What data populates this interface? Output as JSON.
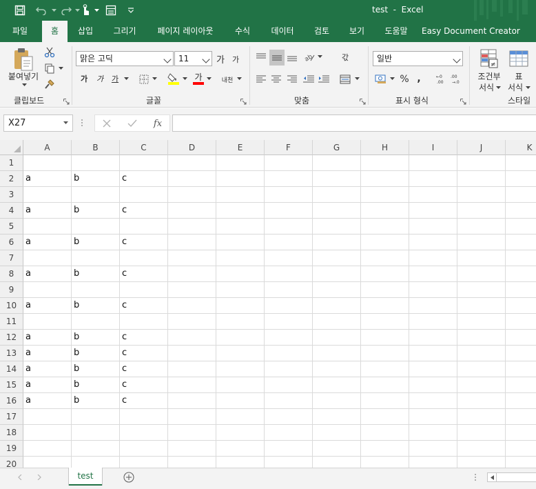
{
  "window": {
    "title": "test  -  Excel",
    "accent_color": "#217346"
  },
  "qat": {
    "icons": [
      "save-icon",
      "undo-icon",
      "redo-icon",
      "touch-mode-icon",
      "form-icon",
      "customize-qat-icon"
    ]
  },
  "tabs": [
    {
      "label": "파일"
    },
    {
      "label": "홈"
    },
    {
      "label": "삽입"
    },
    {
      "label": "그리기"
    },
    {
      "label": "페이지 레이아웃"
    },
    {
      "label": "수식"
    },
    {
      "label": "데이터"
    },
    {
      "label": "검토"
    },
    {
      "label": "보기"
    },
    {
      "label": "도움말"
    },
    {
      "label": "Easy Document Creator"
    }
  ],
  "ribbon": {
    "clipboard": {
      "paste_label": "붙여넣기",
      "group_label": "클립보드"
    },
    "font": {
      "font_name": "맑은 고딕",
      "font_size": "11",
      "grow_label": "가",
      "shrink_label": "가",
      "bold_label": "가",
      "italic_label": "가",
      "underline_label": "가",
      "font_color_label": "가",
      "phonetic_label": "내천",
      "highlight_color": "#ffff00",
      "font_color": "#ff0000",
      "group_label": "글꼴"
    },
    "alignment": {
      "wrap_label": "갃",
      "group_label": "맞춤"
    },
    "number": {
      "format": "일반",
      "percent_label": "%",
      "comma_label": ",",
      "group_label": "표시 형식"
    },
    "styles": {
      "conditional_label_1": "조건부",
      "conditional_label_2": "서식",
      "table_label_1": "표",
      "table_label_2": "서식",
      "group_label": "스타일"
    }
  },
  "formula_bar": {
    "name_box": "X27",
    "fx_label": "fx",
    "formula": ""
  },
  "sheet": {
    "columns": [
      "A",
      "B",
      "C",
      "D",
      "E",
      "F",
      "G",
      "H",
      "I",
      "J",
      "K"
    ],
    "rows": [
      {
        "num": "1",
        "cells": [
          "",
          "",
          ""
        ]
      },
      {
        "num": "2",
        "cells": [
          "a",
          "b",
          "c"
        ]
      },
      {
        "num": "3",
        "cells": [
          "",
          "",
          ""
        ]
      },
      {
        "num": "4",
        "cells": [
          "a",
          "b",
          "c"
        ]
      },
      {
        "num": "5",
        "cells": [
          "",
          "",
          ""
        ]
      },
      {
        "num": "6",
        "cells": [
          "a",
          "b",
          "c"
        ]
      },
      {
        "num": "7",
        "cells": [
          "",
          "",
          ""
        ]
      },
      {
        "num": "8",
        "cells": [
          "a",
          "b",
          "c"
        ]
      },
      {
        "num": "9",
        "cells": [
          "",
          "",
          ""
        ]
      },
      {
        "num": "10",
        "cells": [
          "a",
          "b",
          "c"
        ]
      },
      {
        "num": "11",
        "cells": [
          "",
          "",
          ""
        ]
      },
      {
        "num": "12",
        "cells": [
          "a",
          "b",
          "c"
        ]
      },
      {
        "num": "13",
        "cells": [
          "a",
          "b",
          "c"
        ]
      },
      {
        "num": "14",
        "cells": [
          "a",
          "b",
          "c"
        ]
      },
      {
        "num": "15",
        "cells": [
          "a",
          "b",
          "c"
        ]
      },
      {
        "num": "16",
        "cells": [
          "a",
          "b",
          "c"
        ]
      },
      {
        "num": "17",
        "cells": [
          "",
          "",
          ""
        ]
      },
      {
        "num": "18",
        "cells": [
          "",
          "",
          ""
        ]
      },
      {
        "num": "19",
        "cells": [
          "",
          "",
          ""
        ]
      },
      {
        "num": "20",
        "cells": [
          "",
          "",
          ""
        ]
      }
    ]
  },
  "sheet_tabs": [
    {
      "label": "test"
    }
  ]
}
